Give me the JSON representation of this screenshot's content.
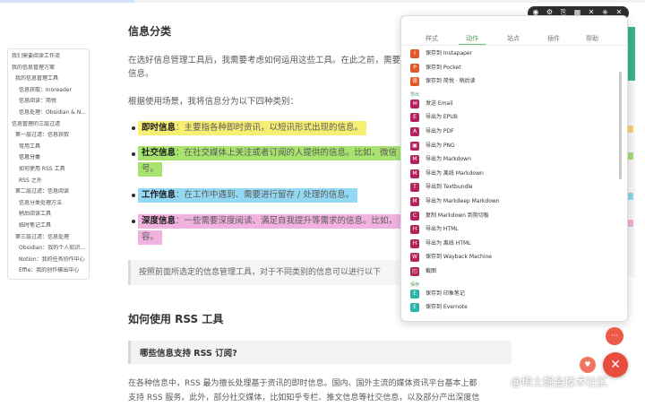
{
  "toc": [
    {
      "label": "我们需要阅读工作流",
      "cls": ""
    },
    {
      "label": "我的信息管理方案",
      "cls": ""
    },
    {
      "label": "我的信息管理工具",
      "cls": ""
    },
    {
      "label": "信息获取：Inoreader",
      "cls": ""
    },
    {
      "label": "信息阅读：简悦",
      "cls": ""
    },
    {
      "label": "信息处理：Obsidian & N...",
      "cls": ""
    },
    {
      "label": "信息管理的三层过滤",
      "cls": ""
    },
    {
      "label": "第一层过滤：信息获取",
      "cls": ""
    },
    {
      "label": "常用工具",
      "cls": ""
    },
    {
      "label": "信息分类",
      "cls": "active"
    },
    {
      "label": "如何使用 RSS 工具",
      "cls": ""
    },
    {
      "label": "RSS 之外",
      "cls": ""
    },
    {
      "label": "第二层过滤：信息阅读",
      "cls": ""
    },
    {
      "label": "信息分类处理方法",
      "cls": ""
    },
    {
      "label": "稍后阅读工具",
      "cls": ""
    },
    {
      "label": "临时笔记工具",
      "cls": ""
    },
    {
      "label": "第三层过滤：信息处理",
      "cls": ""
    },
    {
      "label": "Obsidian：我的个人知识...",
      "cls": ""
    },
    {
      "label": "Notion：我的任务协作中心",
      "cls": ""
    },
    {
      "label": "Effie：我的创作输出中心",
      "cls": ""
    }
  ],
  "article": {
    "heading1": "信息分类",
    "para1_line1": "在选好信息管理工具后，我需要考虑如何运用这些工具。在此之前，需要",
    "para1_line2": "信息。",
    "para2": "根据使用场景，我将信息分为以下四种类别：",
    "items": [
      {
        "term": "即时信息",
        "desc": "：主要指各种即时资讯，以短讯形式出现的信息。"
      },
      {
        "term": "社交信息",
        "desc": "：在社交媒体上关注或者订阅的人提供的信息。比如，微信"
      },
      {
        "term": "",
        "desc": "号。"
      },
      {
        "term": "工作信息",
        "desc": "：在工作中遇到、需要进行留存 / 处理的信息。"
      },
      {
        "term": "深度信息",
        "desc": "：一些需要深度阅读、满足自我提升等需求的信息。比如，"
      },
      {
        "term": "",
        "desc": "容。"
      }
    ],
    "quote": "按照前面所选定的信息管理工具，对于不同类别的信息可以进行以下",
    "heading2": "如何使用 RSS 工具",
    "heading3": "哪些信息支持 RSS 订阅?",
    "para3_line1": "在各种信息中，RSS 最为擅长处理基于资讯的即时信息。国内、国外主流的媒体资讯平台基本上都",
    "para3_line2": "支持 RSS 服务。此外，部分社交媒体，比如知乎专栏、推文信息等社交信息，以及部分产出深度信"
  },
  "panel": {
    "tabs": [
      "样式",
      "动作",
      "站点",
      "插件",
      "帮助"
    ],
    "active_tab": "动作",
    "section_export": "导出",
    "section_save": "保存",
    "items_top": [
      {
        "label": "保存到 Instapaper",
        "color": "#e0592a",
        "icon": "I"
      },
      {
        "label": "保存到 Pocket",
        "color": "#e0592a",
        "icon": "P"
      },
      {
        "label": "保存到 简悦 · 稍后读",
        "color": "#e0592a",
        "icon": "读"
      }
    ],
    "items_export": [
      {
        "label": "发送 Email",
        "color": "#b3245f",
        "icon": "✉"
      },
      {
        "label": "导出为 EPUB",
        "color": "#b3245f",
        "icon": "E"
      },
      {
        "label": "导出为 PDF",
        "color": "#b3245f",
        "icon": "A"
      },
      {
        "label": "导出为 PNG",
        "color": "#b3245f",
        "icon": "▣"
      },
      {
        "label": "导出为 Markdown",
        "color": "#b3245f",
        "icon": "M"
      },
      {
        "label": "导出为 离线 Markdown",
        "color": "#b3245f",
        "icon": "M"
      },
      {
        "label": "导出到 Textbundle",
        "color": "#b3245f",
        "icon": "T"
      },
      {
        "label": "导出为 Markdeep Markdown",
        "color": "#b3245f",
        "icon": "M"
      },
      {
        "label": "复制 Markdown 到剪切板",
        "color": "#b3245f",
        "icon": "C"
      },
      {
        "label": "导出为 HTML",
        "color": "#b3245f",
        "icon": "H"
      },
      {
        "label": "导出为 离线 HTML",
        "color": "#b3245f",
        "icon": "H"
      },
      {
        "label": "保存到 Wayback Machine",
        "color": "#b3245f",
        "icon": "W"
      },
      {
        "label": "截图",
        "color": "#b3245f",
        "icon": "◰"
      }
    ],
    "items_save": [
      {
        "label": "保存到 印象笔记",
        "color": "#2bb3a8",
        "icon": "E"
      },
      {
        "label": "保存到 Evernote",
        "color": "#2bb3a8",
        "icon": "E"
      }
    ]
  },
  "fab": {
    "small_label": "···",
    "big_label": "✕",
    "extra_label": "♥"
  },
  "watermark": "@稀土掘金技术社区",
  "toolbar_icons": [
    "◉",
    "⚙",
    "⎘",
    "▦",
    "✕",
    "⎈",
    "✕"
  ]
}
